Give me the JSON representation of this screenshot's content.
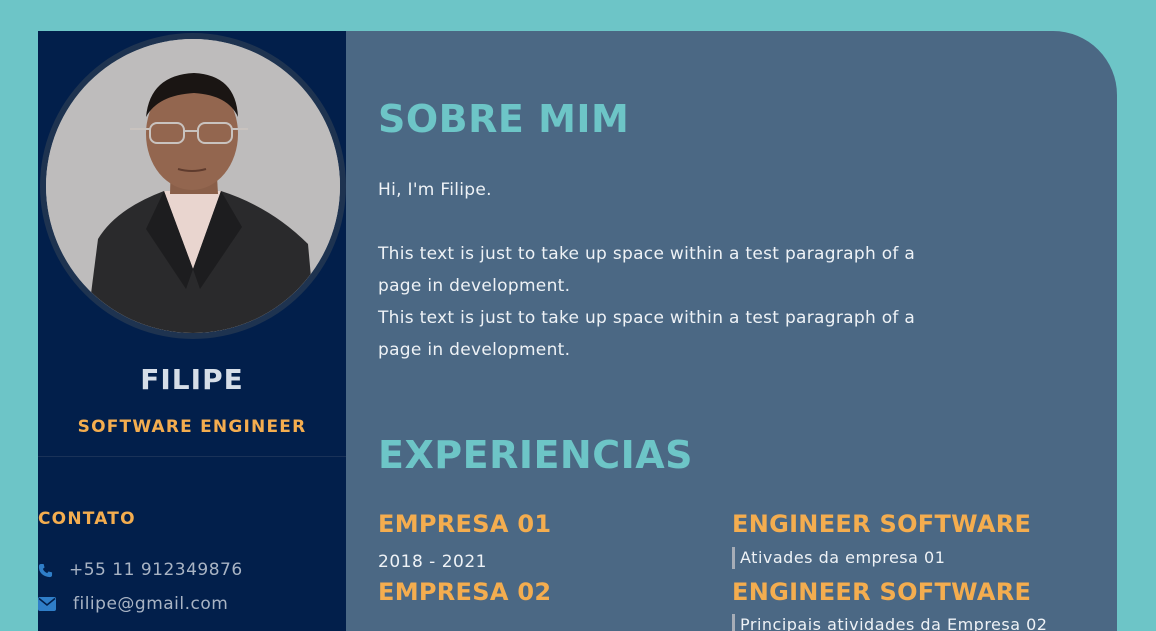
{
  "profile": {
    "name": "FILIPE",
    "role": "SOFTWARE ENGINEER"
  },
  "contact": {
    "title": "CONTATO",
    "phone": "+55 11 912349876",
    "email": "filipe@gmail.com",
    "phone_icon": "phone-icon",
    "email_icon": "envelope-icon"
  },
  "about": {
    "title": "SOBRE MIM",
    "greeting": "Hi, I'm Filipe.",
    "paragraphs": [
      "This text is just to take up space within a test paragraph of a page in development.",
      "This text is just to take up space within a test paragraph of a page in development."
    ]
  },
  "experience": {
    "title": "EXPERIENCIAS",
    "items": [
      {
        "company": "EMPRESA 01",
        "period": "2018 - 2021",
        "role": "ENGINEER SOFTWARE",
        "description": "Ativades da empresa 01"
      },
      {
        "company": "EMPRESA 02",
        "period": "",
        "role": "ENGINEER SOFTWARE",
        "description": "Principais atividades da Empresa 02"
      }
    ]
  },
  "colors": {
    "background": "#6dc5c7",
    "sidebar": "#021f4b",
    "main": "#4b6884",
    "accent": "#f4ad4f",
    "heading": "#6dc5c7"
  }
}
